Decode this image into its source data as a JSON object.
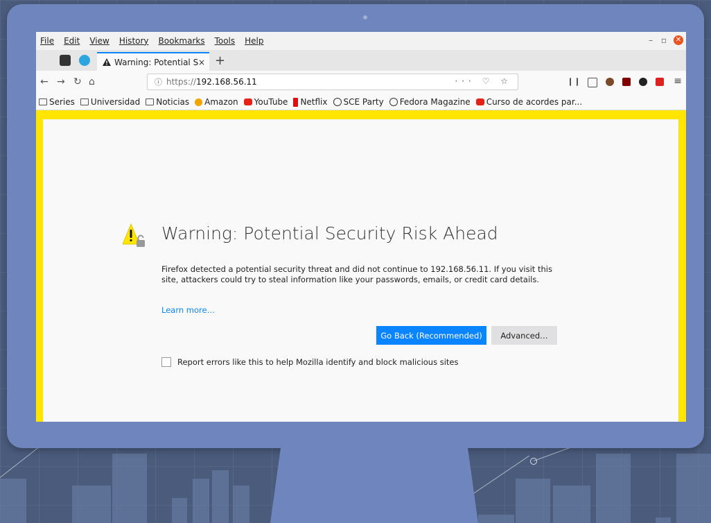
{
  "menubar": {
    "items": [
      "File",
      "Edit",
      "View",
      "History",
      "Bookmarks",
      "Tools",
      "Help"
    ]
  },
  "tab": {
    "title": "Warning: Potential Secur",
    "close_glyph": "×",
    "new_tab_glyph": "+"
  },
  "navbar": {
    "url_protocol": "https://",
    "url_host": "192.168.56.11",
    "page_actions": "··· ♡ ☆",
    "back_glyph": "←",
    "forward_glyph": "→",
    "reload_glyph": "↻",
    "home_glyph": "⌂",
    "menu_glyph": "≡"
  },
  "bookmarks": [
    {
      "label": "Series",
      "icon": "folder-icon",
      "color": "#555555"
    },
    {
      "label": "Universidad",
      "icon": "folder-icon",
      "color": "#555555"
    },
    {
      "label": "Noticias",
      "icon": "folder-icon",
      "color": "#555555"
    },
    {
      "label": "Amazon",
      "icon": "amazon-icon",
      "color": "#f0a500"
    },
    {
      "label": "YouTube",
      "icon": "youtube-icon",
      "color": "#e62117"
    },
    {
      "label": "Netflix",
      "icon": "netflix-icon",
      "color": "#e50914"
    },
    {
      "label": "SCE Party",
      "icon": "globe-icon",
      "color": "#333333"
    },
    {
      "label": "Fedora Magazine",
      "icon": "globe-icon",
      "color": "#333333"
    },
    {
      "label": "Curso de acordes par...",
      "icon": "youtube-icon",
      "color": "#e62117"
    }
  ],
  "page": {
    "heading": "Warning: Potential Security Risk Ahead",
    "description": "Firefox detected a potential security threat and did not continue to 192.168.56.11. If you visit this site, attackers could try to steal information like your passwords, emails, or credit card details.",
    "learn_more": "Learn more…",
    "go_back": "Go Back (Recommended)",
    "advanced": "Advanced…",
    "report": "Report errors like this to help Mozilla identify and block malicious sites"
  },
  "colors": {
    "accent": "#0a84ff",
    "warning_border": "#ffe500",
    "monitor": "#6e86bd"
  }
}
